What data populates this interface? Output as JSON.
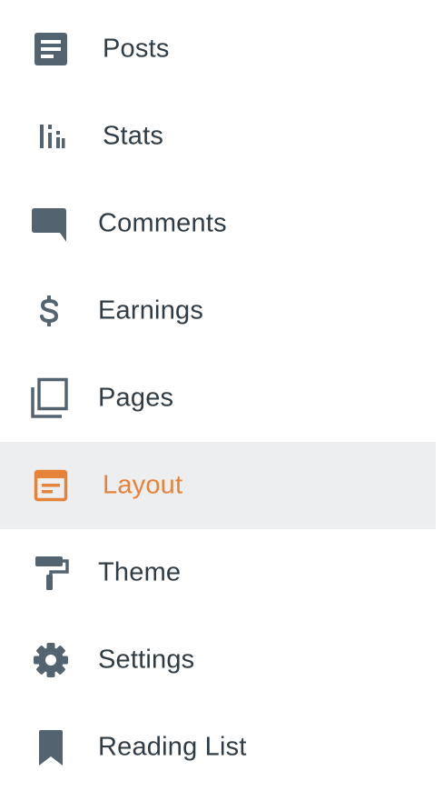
{
  "colors": {
    "icon": "#536470",
    "text": "#2f3c45",
    "active_accent": "#e5833a",
    "active_background": "#eceef0"
  },
  "nav": {
    "items": [
      {
        "label": "Posts",
        "icon": "posts-icon"
      },
      {
        "label": "Stats",
        "icon": "stats-icon"
      },
      {
        "label": "Comments",
        "icon": "comments-icon"
      },
      {
        "label": "Earnings",
        "icon": "dollar-icon"
      },
      {
        "label": "Pages",
        "icon": "pages-icon"
      },
      {
        "label": "Layout",
        "icon": "layout-icon",
        "active": true
      },
      {
        "label": "Theme",
        "icon": "paint-roller-icon"
      },
      {
        "label": "Settings",
        "icon": "gear-icon"
      },
      {
        "label": "Reading List",
        "icon": "bookmark-icon"
      }
    ]
  }
}
